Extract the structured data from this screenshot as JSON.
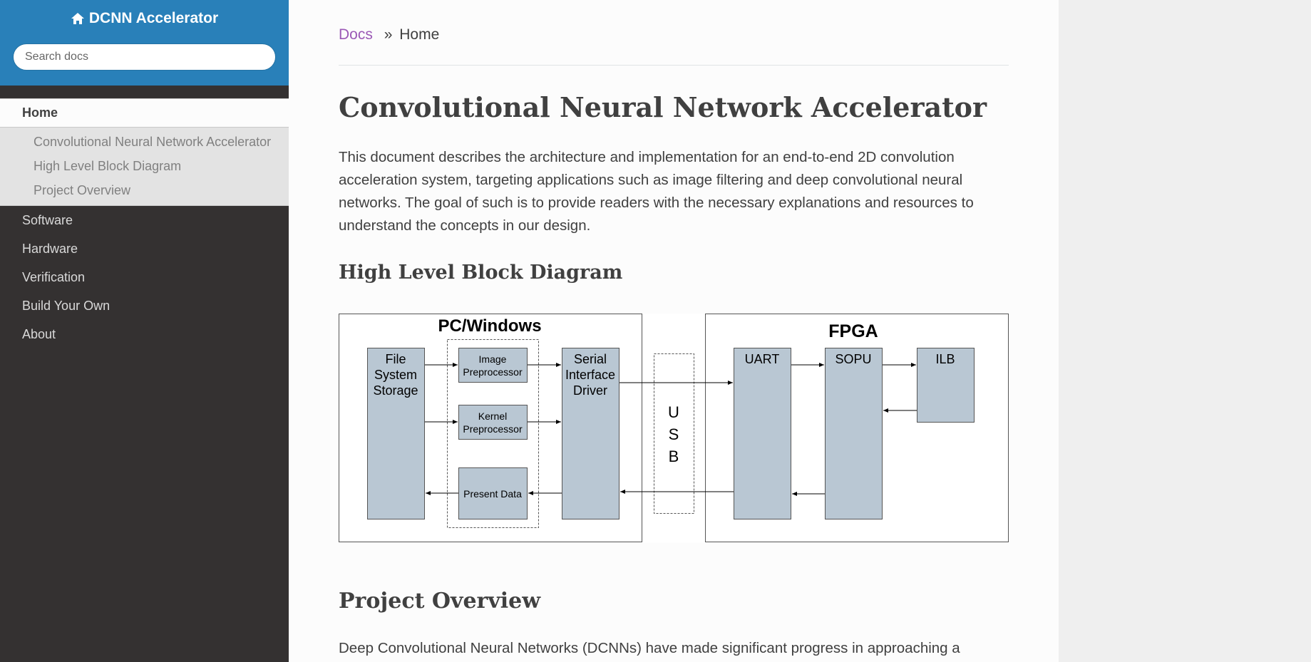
{
  "sidebar": {
    "brand": "DCNN Accelerator",
    "search_placeholder": "Search docs",
    "home": "Home",
    "subitems": [
      "Convolutional Neural Network Accelerator",
      "High Level Block Diagram",
      "Project Overview"
    ],
    "items": [
      "Software",
      "Hardware",
      "Verification",
      "Build Your Own",
      "About"
    ]
  },
  "breadcrumb": {
    "docs": "Docs",
    "separator": "»",
    "current": "Home"
  },
  "main": {
    "title": "Convolutional Neural Network Accelerator",
    "intro": "This document describes the architecture and implementation for an end-to-end 2D convolution acceleration system, targeting applications such as image filtering and deep convolutional neural networks. The goal of such is to provide readers with the necessary explanations and resources to understand the concepts in our design.",
    "section1": "High Level Block Diagram",
    "section2": "Project Overview",
    "tail": "Deep Convolutional Neural Networks (DCNNs) have made significant progress in approaching a"
  },
  "diagram": {
    "pc_title": "PC/Windows",
    "fpga_title": "FPGA",
    "file_storage": [
      "File",
      "System",
      "Storage"
    ],
    "image_pre": [
      "Image",
      "Preprocessor"
    ],
    "kernel_pre": [
      "Kernel",
      "Preprocessor"
    ],
    "present": "Present Data",
    "serial": [
      "Serial",
      "Interface",
      "Driver"
    ],
    "usb": [
      "U",
      "S",
      "B"
    ],
    "uart": "UART",
    "sopu": "SOPU",
    "ilb": "ILB"
  },
  "colors": {
    "sidebar_top": "#2980b9",
    "sidebar_bg": "#343131",
    "link": "#9b59b6",
    "block_fill": "#b9c7d3"
  }
}
